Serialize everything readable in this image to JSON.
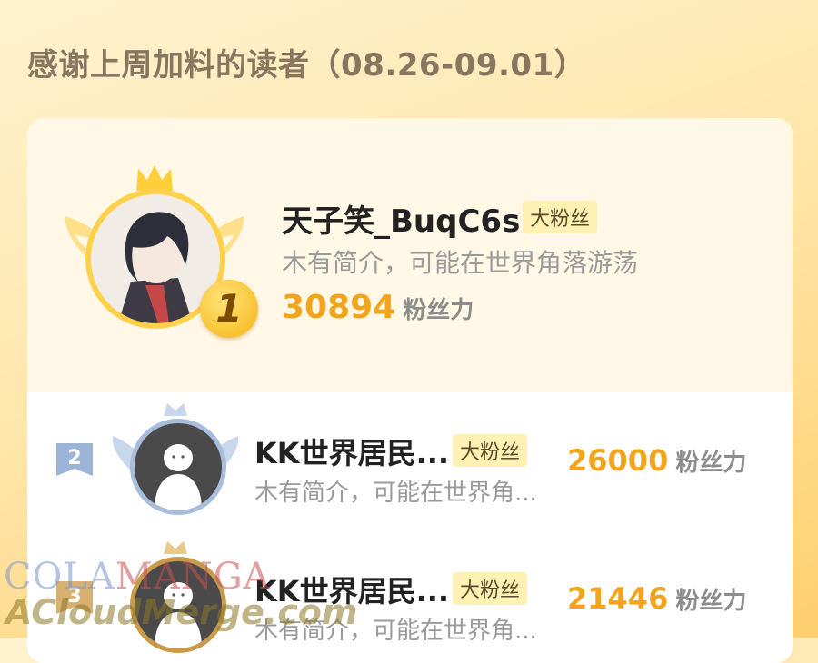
{
  "header": {
    "title": "感谢上周加料的读者（08.26-09.01）"
  },
  "readers": [
    {
      "rank": "1",
      "name": "天子笑_BuqC6s",
      "tag": "大粉丝",
      "bio": "木有简介，可能在世界角落游荡",
      "score": "30894",
      "score_label": "粉丝力"
    },
    {
      "rank": "2",
      "name": "KK世界居民...",
      "tag": "大粉丝",
      "bio": "木有简介，可能在世界角...",
      "score": "26000",
      "score_label": "粉丝力"
    },
    {
      "rank": "3",
      "name": "KK世界居民...",
      "tag": "大粉丝",
      "bio": "木有简介，可能在世界角...",
      "score": "21446",
      "score_label": "粉丝力"
    }
  ],
  "watermark": {
    "line1_a": "COLA",
    "line1_b": "MANGA",
    "line2": "ACloudMerge.com"
  },
  "colors": {
    "accent": "#f2a51c",
    "tag_bg": "#fff0b3",
    "gold": "#ffd04a",
    "silver": "#a8bddb",
    "bronze": "#c99a4a"
  },
  "icons": [
    "crown-icon",
    "wings-icon",
    "rank-badge-icon",
    "default-avatar-icon"
  ]
}
